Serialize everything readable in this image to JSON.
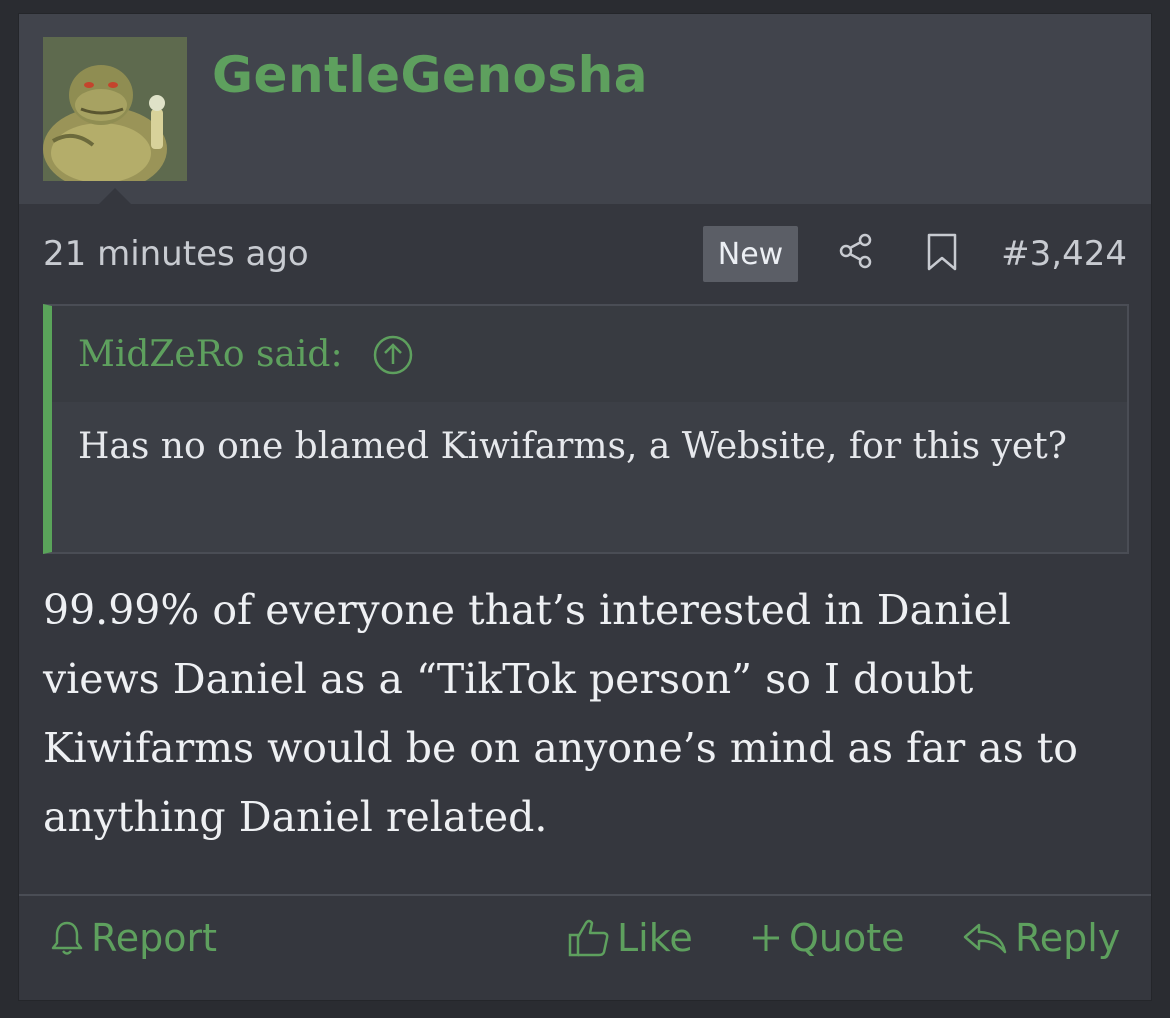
{
  "post": {
    "username": "GentleGenosha",
    "timestamp": "21 minutes ago",
    "new_badge": "New",
    "post_number": "#3,424",
    "quote": {
      "author": "MidZeRo said:",
      "text": "Has no one blamed Kiwifarms, a Website, for this yet?"
    },
    "message": "99.99% of everyone that’s interested in Daniel views Daniel as a “TikTok person” so I doubt Kiwifarms would be on anyone’s mind as far as to anything Daniel related."
  },
  "actions": {
    "report": "Report",
    "like": "Like",
    "quote": "Quote",
    "reply": "Reply"
  },
  "icons": {
    "avatar": "jabba-avatar",
    "share": "share-icon",
    "bookmark": "bookmark-icon",
    "quote_jump": "arrow-up-circle-icon",
    "report": "bell-icon",
    "like": "thumbs-up-icon",
    "quote": "plus-icon",
    "reply": "reply-arrow-icon"
  },
  "colors": {
    "accent_green": "#5ea05e",
    "post_bg": "#35373e",
    "header_bg": "#41444c"
  }
}
